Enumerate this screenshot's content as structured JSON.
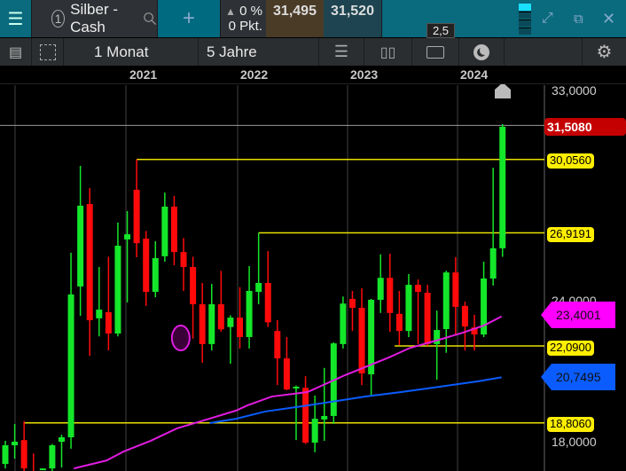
{
  "header": {
    "symbol_number": "1",
    "symbol": "Silber - Cash",
    "change_pct": "0 %",
    "change_pts": "0 Pkt.",
    "bid": "31,495",
    "ask": "31,520",
    "spread": "2,5"
  },
  "toolbar": {
    "interval": "1 Monat",
    "range": "5 Jahre"
  },
  "years": [
    "2021",
    "2022",
    "2023",
    "2024"
  ],
  "axis": {
    "labels": [
      "33,0000",
      "24,0000",
      "18,0000"
    ]
  },
  "tags": {
    "last": "31,5080",
    "level1": "30,0560",
    "level2": "26,9191",
    "ma1": "23,4001",
    "level3": "22,0900",
    "ma2": "20,7495",
    "level4": "18,8060"
  },
  "colors": {
    "up": "#14e62a",
    "down": "#ff0a0a",
    "ma1": "#e01ce0",
    "ma2": "#0a5cff",
    "level": "#e8e000",
    "last": "#c40000",
    "accent": "#0a6a7e"
  },
  "chart_data": {
    "type": "candlestick",
    "ylim": [
      15.5,
      34.0
    ],
    "candles": [
      [
        17.05,
        17.85,
        18.04,
        16.86
      ],
      [
        17.85,
        18.0,
        18.76,
        17.28
      ],
      [
        18.07,
        16.86,
        18.87,
        16.5
      ],
      [
        16.6,
        16.5,
        17.5,
        16.3
      ],
      [
        16.86,
        16.86,
        16.86,
        16.86
      ],
      [
        16.86,
        17.85,
        17.9,
        16.5
      ],
      [
        18.0,
        18.19,
        18.3,
        16.9
      ],
      [
        18.19,
        24.29,
        26.07,
        17.7
      ],
      [
        24.63,
        28.08,
        29.78,
        23.38
      ],
      [
        28.15,
        23.19,
        28.83,
        21.67
      ],
      [
        23.27,
        23.64,
        25.46,
        22.5
      ],
      [
        23.53,
        22.62,
        25.9,
        21.9
      ],
      [
        22.62,
        26.37,
        27.36,
        22.5
      ],
      [
        26.64,
        26.86,
        27.85,
        23.95
      ],
      [
        28.76,
        26.48,
        30.056,
        25.88
      ],
      [
        26.67,
        24.4,
        27.0,
        23.8
      ],
      [
        24.4,
        25.84,
        26.56,
        24.17
      ],
      [
        25.92,
        28.04,
        28.64,
        25.69
      ],
      [
        28.04,
        26.1,
        28.5,
        25.54
      ],
      [
        26.1,
        25.46,
        26.7,
        24.44
      ],
      [
        25.46,
        23.87,
        25.9,
        22.4
      ],
      [
        23.87,
        22.17,
        24.78,
        21.37
      ],
      [
        22.17,
        23.87,
        24.74,
        21.9
      ],
      [
        23.87,
        22.8,
        25.3,
        22.7
      ],
      [
        22.9,
        23.3,
        23.4,
        21.33
      ],
      [
        23.3,
        22.47,
        24.6,
        21.98
      ],
      [
        22.47,
        24.44,
        25.5,
        21.98
      ],
      [
        24.4,
        24.78,
        26.92,
        23.87
      ],
      [
        24.78,
        23.1,
        26.14,
        22.9
      ],
      [
        22.73,
        21.56,
        23.19,
        20.42
      ],
      [
        21.56,
        20.23,
        22.47,
        20.2
      ],
      [
        20.3,
        20.35,
        20.4,
        18.07
      ],
      [
        20.3,
        17.96,
        20.8,
        17.9
      ],
      [
        17.96,
        18.98,
        19.97,
        17.55
      ],
      [
        18.95,
        19.1,
        21.15,
        18.04
      ],
      [
        19.1,
        22.2,
        22.24,
        18.76
      ],
      [
        22.17,
        23.9,
        24.2,
        21.98
      ],
      [
        24.1,
        23.72,
        24.44,
        22.73
      ],
      [
        23.72,
        20.92,
        24.55,
        20.42
      ],
      [
        20.88,
        24.06,
        24.1,
        19.93
      ],
      [
        24.06,
        25.0,
        26.0,
        23.5
      ],
      [
        25.0,
        23.5,
        26.03,
        22.7
      ],
      [
        23.46,
        22.73,
        24.44,
        22.13
      ],
      [
        22.73,
        24.7,
        25.16,
        22.47
      ],
      [
        24.7,
        24.4,
        24.93,
        22.17
      ],
      [
        24.36,
        22.17,
        24.7,
        22.1
      ],
      [
        22.17,
        22.77,
        23.6,
        20.65
      ],
      [
        22.81,
        25.23,
        25.3,
        21.8
      ],
      [
        25.23,
        23.76,
        25.88,
        22.55
      ],
      [
        23.8,
        22.92,
        23.98,
        21.9
      ],
      [
        22.88,
        22.58,
        23.42,
        21.9
      ],
      [
        22.58,
        24.97,
        25.69,
        22.47
      ],
      [
        24.97,
        26.26,
        29.7,
        24.67
      ],
      [
        26.26,
        31.45,
        31.56,
        25.9
      ]
    ],
    "ma1": [
      [
        7.3,
        16.86
      ],
      [
        10.8,
        17.2
      ],
      [
        12.6,
        17.58
      ],
      [
        15.5,
        18.04
      ],
      [
        18.3,
        18.57
      ],
      [
        20.8,
        18.87
      ],
      [
        24.6,
        19.33
      ],
      [
        25.8,
        19.55
      ],
      [
        28.4,
        19.93
      ],
      [
        32.2,
        20.12
      ],
      [
        36.2,
        20.84
      ],
      [
        40.9,
        21.6
      ],
      [
        43.1,
        22.0
      ],
      [
        46.3,
        22.36
      ],
      [
        48.8,
        22.66
      ],
      [
        51,
        22.96
      ],
      [
        52.9,
        23.35
      ]
    ],
    "ma2": [
      [
        21.8,
        18.8
      ],
      [
        24.6,
        18.98
      ],
      [
        27.7,
        19.29
      ],
      [
        32.2,
        19.55
      ],
      [
        35.3,
        19.74
      ],
      [
        38.4,
        19.93
      ],
      [
        42.2,
        20.12
      ],
      [
        46.3,
        20.35
      ],
      [
        50.4,
        20.58
      ],
      [
        52.9,
        20.75
      ]
    ],
    "levels": [
      [
        14,
        30.056
      ],
      [
        27,
        26.9191
      ],
      [
        41.5,
        22.09
      ],
      [
        2,
        18.806
      ]
    ],
    "last_price": 31.508,
    "marker": [
      18.7,
      22.43
    ]
  }
}
